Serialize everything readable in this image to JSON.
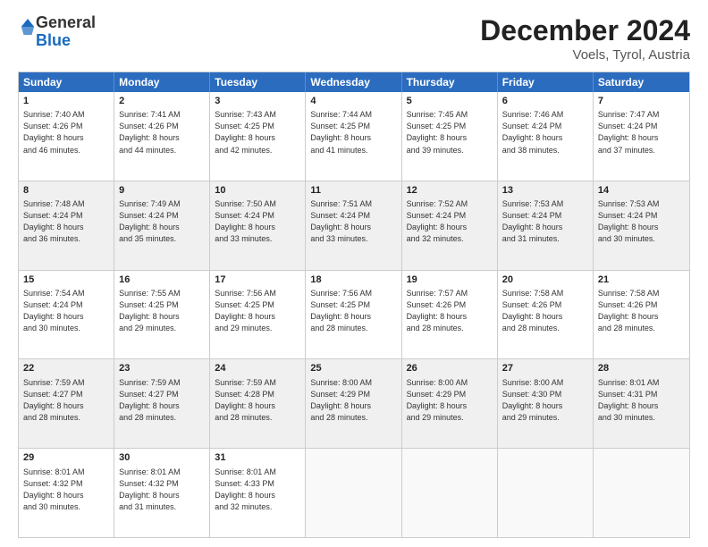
{
  "logo": {
    "general": "General",
    "blue": "Blue"
  },
  "title": "December 2024",
  "location": "Voels, Tyrol, Austria",
  "header_days": [
    "Sunday",
    "Monday",
    "Tuesday",
    "Wednesday",
    "Thursday",
    "Friday",
    "Saturday"
  ],
  "rows": [
    {
      "shaded": false,
      "cells": [
        {
          "day": "1",
          "lines": [
            "Sunrise: 7:40 AM",
            "Sunset: 4:26 PM",
            "Daylight: 8 hours",
            "and 46 minutes."
          ]
        },
        {
          "day": "2",
          "lines": [
            "Sunrise: 7:41 AM",
            "Sunset: 4:26 PM",
            "Daylight: 8 hours",
            "and 44 minutes."
          ]
        },
        {
          "day": "3",
          "lines": [
            "Sunrise: 7:43 AM",
            "Sunset: 4:25 PM",
            "Daylight: 8 hours",
            "and 42 minutes."
          ]
        },
        {
          "day": "4",
          "lines": [
            "Sunrise: 7:44 AM",
            "Sunset: 4:25 PM",
            "Daylight: 8 hours",
            "and 41 minutes."
          ]
        },
        {
          "day": "5",
          "lines": [
            "Sunrise: 7:45 AM",
            "Sunset: 4:25 PM",
            "Daylight: 8 hours",
            "and 39 minutes."
          ]
        },
        {
          "day": "6",
          "lines": [
            "Sunrise: 7:46 AM",
            "Sunset: 4:24 PM",
            "Daylight: 8 hours",
            "and 38 minutes."
          ]
        },
        {
          "day": "7",
          "lines": [
            "Sunrise: 7:47 AM",
            "Sunset: 4:24 PM",
            "Daylight: 8 hours",
            "and 37 minutes."
          ]
        }
      ]
    },
    {
      "shaded": true,
      "cells": [
        {
          "day": "8",
          "lines": [
            "Sunrise: 7:48 AM",
            "Sunset: 4:24 PM",
            "Daylight: 8 hours",
            "and 36 minutes."
          ]
        },
        {
          "day": "9",
          "lines": [
            "Sunrise: 7:49 AM",
            "Sunset: 4:24 PM",
            "Daylight: 8 hours",
            "and 35 minutes."
          ]
        },
        {
          "day": "10",
          "lines": [
            "Sunrise: 7:50 AM",
            "Sunset: 4:24 PM",
            "Daylight: 8 hours",
            "and 33 minutes."
          ]
        },
        {
          "day": "11",
          "lines": [
            "Sunrise: 7:51 AM",
            "Sunset: 4:24 PM",
            "Daylight: 8 hours",
            "and 33 minutes."
          ]
        },
        {
          "day": "12",
          "lines": [
            "Sunrise: 7:52 AM",
            "Sunset: 4:24 PM",
            "Daylight: 8 hours",
            "and 32 minutes."
          ]
        },
        {
          "day": "13",
          "lines": [
            "Sunrise: 7:53 AM",
            "Sunset: 4:24 PM",
            "Daylight: 8 hours",
            "and 31 minutes."
          ]
        },
        {
          "day": "14",
          "lines": [
            "Sunrise: 7:53 AM",
            "Sunset: 4:24 PM",
            "Daylight: 8 hours",
            "and 30 minutes."
          ]
        }
      ]
    },
    {
      "shaded": false,
      "cells": [
        {
          "day": "15",
          "lines": [
            "Sunrise: 7:54 AM",
            "Sunset: 4:24 PM",
            "Daylight: 8 hours",
            "and 30 minutes."
          ]
        },
        {
          "day": "16",
          "lines": [
            "Sunrise: 7:55 AM",
            "Sunset: 4:25 PM",
            "Daylight: 8 hours",
            "and 29 minutes."
          ]
        },
        {
          "day": "17",
          "lines": [
            "Sunrise: 7:56 AM",
            "Sunset: 4:25 PM",
            "Daylight: 8 hours",
            "and 29 minutes."
          ]
        },
        {
          "day": "18",
          "lines": [
            "Sunrise: 7:56 AM",
            "Sunset: 4:25 PM",
            "Daylight: 8 hours",
            "and 28 minutes."
          ]
        },
        {
          "day": "19",
          "lines": [
            "Sunrise: 7:57 AM",
            "Sunset: 4:26 PM",
            "Daylight: 8 hours",
            "and 28 minutes."
          ]
        },
        {
          "day": "20",
          "lines": [
            "Sunrise: 7:58 AM",
            "Sunset: 4:26 PM",
            "Daylight: 8 hours",
            "and 28 minutes."
          ]
        },
        {
          "day": "21",
          "lines": [
            "Sunrise: 7:58 AM",
            "Sunset: 4:26 PM",
            "Daylight: 8 hours",
            "and 28 minutes."
          ]
        }
      ]
    },
    {
      "shaded": true,
      "cells": [
        {
          "day": "22",
          "lines": [
            "Sunrise: 7:59 AM",
            "Sunset: 4:27 PM",
            "Daylight: 8 hours",
            "and 28 minutes."
          ]
        },
        {
          "day": "23",
          "lines": [
            "Sunrise: 7:59 AM",
            "Sunset: 4:27 PM",
            "Daylight: 8 hours",
            "and 28 minutes."
          ]
        },
        {
          "day": "24",
          "lines": [
            "Sunrise: 7:59 AM",
            "Sunset: 4:28 PM",
            "Daylight: 8 hours",
            "and 28 minutes."
          ]
        },
        {
          "day": "25",
          "lines": [
            "Sunrise: 8:00 AM",
            "Sunset: 4:29 PM",
            "Daylight: 8 hours",
            "and 28 minutes."
          ]
        },
        {
          "day": "26",
          "lines": [
            "Sunrise: 8:00 AM",
            "Sunset: 4:29 PM",
            "Daylight: 8 hours",
            "and 29 minutes."
          ]
        },
        {
          "day": "27",
          "lines": [
            "Sunrise: 8:00 AM",
            "Sunset: 4:30 PM",
            "Daylight: 8 hours",
            "and 29 minutes."
          ]
        },
        {
          "day": "28",
          "lines": [
            "Sunrise: 8:01 AM",
            "Sunset: 4:31 PM",
            "Daylight: 8 hours",
            "and 30 minutes."
          ]
        }
      ]
    },
    {
      "shaded": false,
      "cells": [
        {
          "day": "29",
          "lines": [
            "Sunrise: 8:01 AM",
            "Sunset: 4:32 PM",
            "Daylight: 8 hours",
            "and 30 minutes."
          ]
        },
        {
          "day": "30",
          "lines": [
            "Sunrise: 8:01 AM",
            "Sunset: 4:32 PM",
            "Daylight: 8 hours",
            "and 31 minutes."
          ]
        },
        {
          "day": "31",
          "lines": [
            "Sunrise: 8:01 AM",
            "Sunset: 4:33 PM",
            "Daylight: 8 hours",
            "and 32 minutes."
          ]
        },
        {
          "day": "",
          "lines": []
        },
        {
          "day": "",
          "lines": []
        },
        {
          "day": "",
          "lines": []
        },
        {
          "day": "",
          "lines": []
        }
      ]
    }
  ]
}
